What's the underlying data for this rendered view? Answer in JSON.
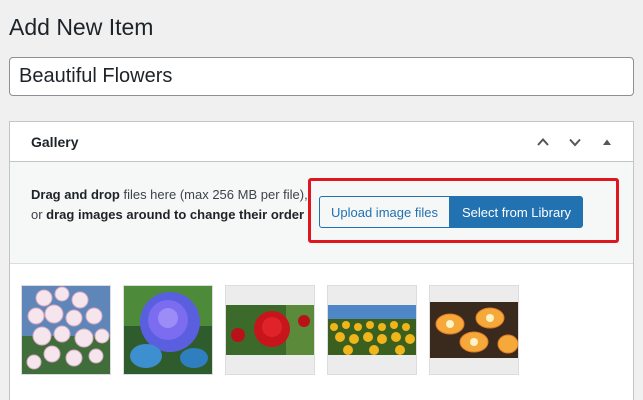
{
  "page": {
    "title": "Add New Item"
  },
  "post": {
    "title_value": "Beautiful Flowers"
  },
  "gallery": {
    "title": "Gallery",
    "controls": [
      {
        "name": "move-up",
        "icon": "chevron-up-icon"
      },
      {
        "name": "move-down",
        "icon": "chevron-down-icon"
      },
      {
        "name": "toggle-panel",
        "icon": "triangle-up-icon"
      }
    ],
    "dropzone": {
      "part1_bold": "Drag and drop",
      "part2": " files here (max 256 MB per file), or ",
      "part3_bold": "drag images around to change their order"
    },
    "upload_label": "Upload image files",
    "library_label": "Select from Library",
    "accent_color": "#2271b1",
    "highlight_color": "#e0161e",
    "images": [
      {
        "name": "white-daisy-flowers"
      },
      {
        "name": "blue-rose"
      },
      {
        "name": "red-rose"
      },
      {
        "name": "sunflower-field"
      },
      {
        "name": "plumeria-flowers"
      }
    ]
  }
}
